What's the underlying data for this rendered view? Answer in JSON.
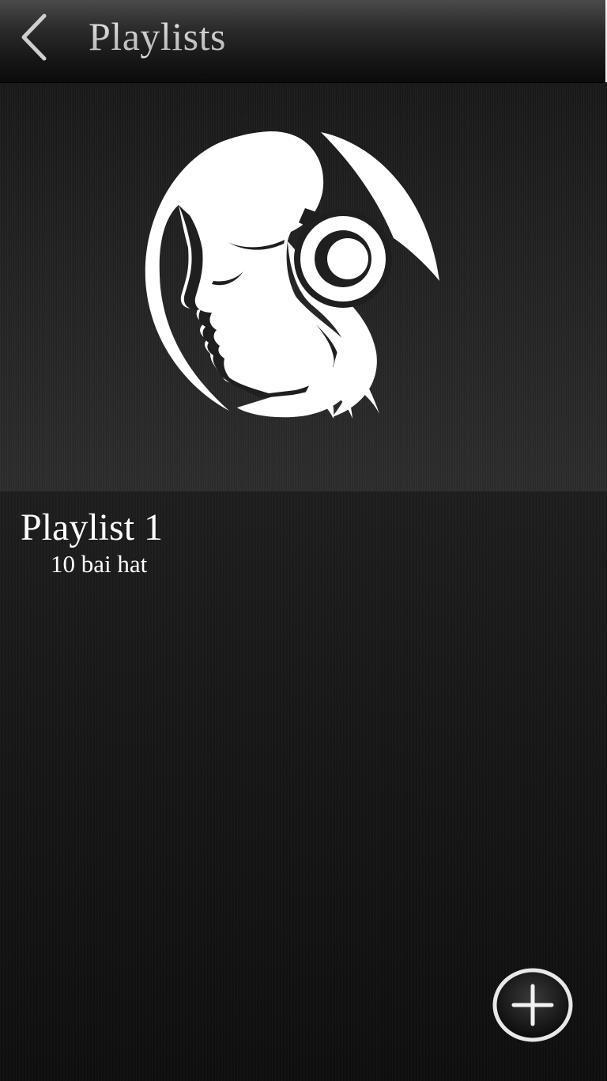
{
  "header": {
    "title": "Playlists",
    "back_icon": "chevron-left-icon"
  },
  "artwork": {
    "icon": "headphones-woman-icon"
  },
  "playlists": [
    {
      "name": "Playlist 1",
      "count_label": "10 bai hat"
    }
  ],
  "add_button": {
    "icon": "plus-circle-icon"
  },
  "colors": {
    "background": "#1a1a1a",
    "header": "#202020",
    "text": "#ffffff",
    "header_text": "#d9d9d9"
  }
}
